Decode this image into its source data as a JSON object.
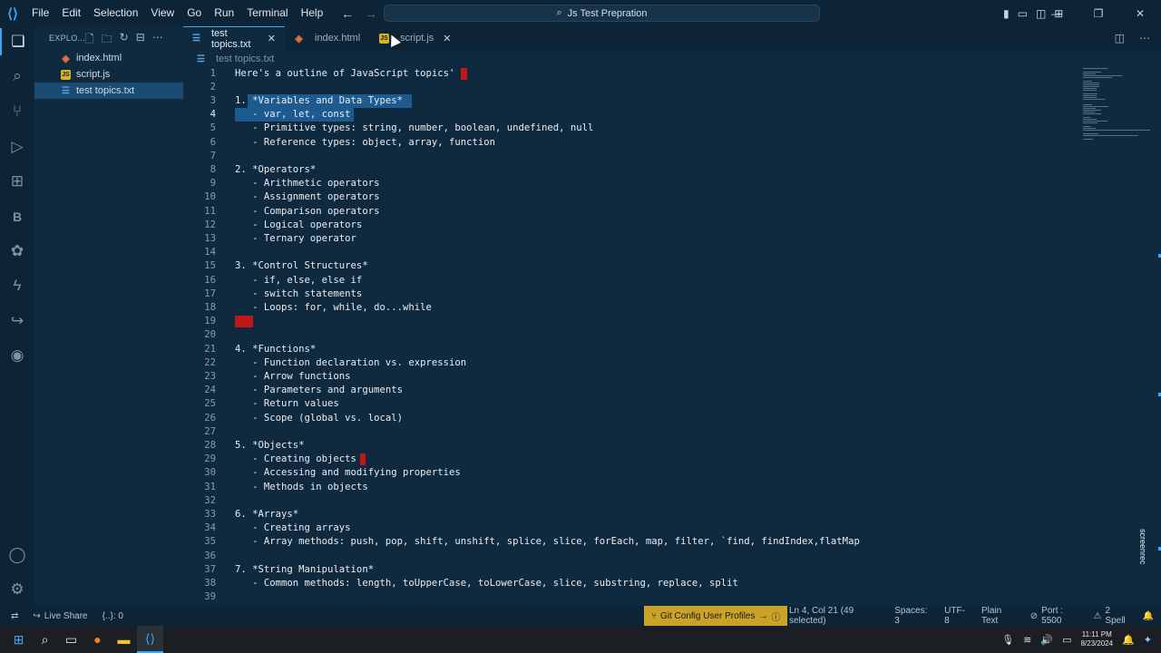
{
  "titlebar": {
    "menu": [
      "File",
      "Edit",
      "Selection",
      "View",
      "Go",
      "Run",
      "Terminal",
      "Help"
    ],
    "search": "Js Test Prepration"
  },
  "sidebar": {
    "header": "EXPLO...",
    "files": [
      {
        "name": "index.html",
        "kind": "html"
      },
      {
        "name": "script.js",
        "kind": "js"
      },
      {
        "name": "test topics.txt",
        "kind": "txt"
      }
    ]
  },
  "tabs": [
    {
      "label": "test topics.txt",
      "kind": "txt",
      "active": true
    },
    {
      "label": "index.html",
      "kind": "html",
      "active": false
    },
    {
      "label": "script.js",
      "kind": "js",
      "active": false
    }
  ],
  "breadcrumb": "test topics.txt",
  "editor": {
    "lines": [
      "Here's a outline of JavaScript topics'",
      "",
      "1. *Variables and Data Types*",
      "   - var, let, const",
      "   - Primitive types: string, number, boolean, undefined, null",
      "   - Reference types: object, array, function",
      "",
      "2. *Operators*",
      "   - Arithmetic operators",
      "   - Assignment operators",
      "   - Comparison operators",
      "   - Logical operators",
      "   - Ternary operator",
      "",
      "3. *Control Structures*",
      "   - if, else, else if",
      "   - switch statements",
      "   - Loops: for, while, do...while",
      "",
      "",
      "4. *Functions*",
      "   - Function declaration vs. expression",
      "   - Arrow functions",
      "   - Parameters and arguments",
      "   - Return values",
      "   - Scope (global vs. local)",
      "",
      "5. *Objects*",
      "   - Creating objects",
      "   - Accessing and modifying properties",
      "   - Methods in objects",
      "",
      "6. *Arrays*",
      "   - Creating arrays",
      "   - Array methods: push, pop, shift, unshift, splice, slice, forEach, map, filter, `find, findIndex,flatMap",
      "",
      "7. *String Manipulation*",
      "   - Common methods: length, toUpperCase, toLowerCase, slice, substring, replace, split",
      "",
      "8. *DOM Basics*"
    ],
    "current_line": 4
  },
  "statusbar": {
    "live_share": "Live Share",
    "braces": "{..}: 0",
    "git_config": "Git Config User Profiles",
    "cursor": "Ln 4, Col 21 (49 selected)",
    "spaces": "Spaces: 3",
    "encoding": "UTF-8",
    "language": "Plain Text",
    "port": "Port : 5500",
    "spell": "2 Spell"
  },
  "taskbar": {
    "time": "11:11 PM",
    "date": "8/23/2024"
  },
  "watermark": "screenrec"
}
